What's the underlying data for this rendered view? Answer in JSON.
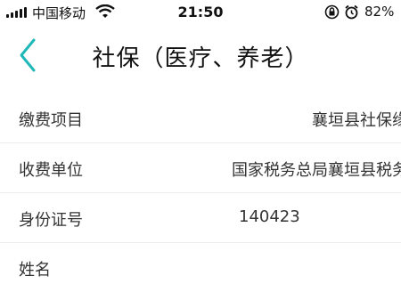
{
  "status_bar": {
    "carrier": "中国移动",
    "time": "21:50",
    "battery": "82%",
    "icons": [
      "signal-icon",
      "wifi-icon",
      "rotation-lock-icon",
      "alarm-icon",
      "battery-icon"
    ]
  },
  "nav": {
    "title": "社保（医疗、养老）",
    "back_icon": "chevron-left-icon"
  },
  "colors": {
    "accent": "#1fb8b8",
    "divider": "#ececec",
    "text": "#333333"
  },
  "rows": [
    {
      "label": "缴费项目",
      "value": "襄垣县社保缘"
    },
    {
      "label": "收费单位",
      "value": "国家税务总局襄垣县税务"
    },
    {
      "label": "身份证号",
      "value": "140423"
    },
    {
      "label": "姓名",
      "value": ""
    }
  ]
}
